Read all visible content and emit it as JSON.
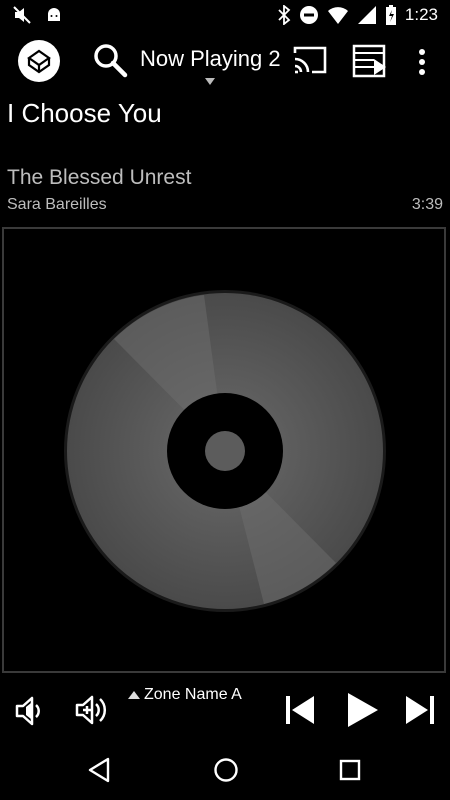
{
  "status": {
    "time": "1:23"
  },
  "appbar": {
    "now_playing_label": "Now Playing 2"
  },
  "track": {
    "title": "I Choose You",
    "album": "The Blessed Unrest",
    "artist": "Sara Bareilles",
    "duration": "3:39"
  },
  "controls": {
    "zone_label": "Zone Name A"
  },
  "icons": {
    "logo": "app-logo-icon",
    "search": "search-icon",
    "cast": "cast-icon",
    "queue": "queue-icon",
    "more": "more-vert-icon",
    "vol_down": "volume-down-icon",
    "vol_up": "volume-up-icon",
    "prev": "skip-previous-icon",
    "play": "play-icon",
    "next": "skip-next-icon"
  },
  "colors": {
    "background": "#000000",
    "text": "#ffffff",
    "secondary_text": "#bdbdbd",
    "frame": "#3a3a3a"
  }
}
